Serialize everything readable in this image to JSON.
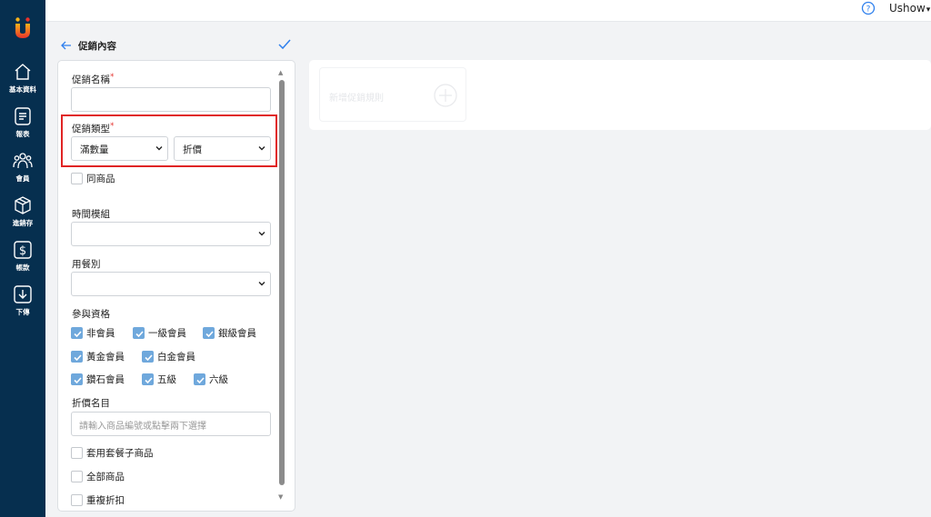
{
  "sidebar": {
    "items": [
      {
        "label": "基本資料",
        "icon": "home-icon"
      },
      {
        "label": "報表",
        "icon": "report-icon"
      },
      {
        "label": "會員",
        "icon": "members-icon"
      },
      {
        "label": "進銷存",
        "icon": "inventory-box-icon"
      },
      {
        "label": "帳款",
        "icon": "dollar-icon"
      },
      {
        "label": "下傳",
        "icon": "download-icon"
      }
    ]
  },
  "topbar": {
    "user": "Ushow",
    "caret": "▾"
  },
  "header": {
    "title": "促銷內容"
  },
  "form": {
    "promo_name": {
      "label": "促銷名稱",
      "required_mark": "*",
      "value": ""
    },
    "promo_type": {
      "label": "促銷類型",
      "required_mark": "*",
      "select1": "滿數量",
      "select2": "折價"
    },
    "same_product": {
      "label": "同商品",
      "checked": false
    },
    "time_template": {
      "label": "時間模組",
      "value": ""
    },
    "dining_type": {
      "label": "用餐別",
      "value": ""
    },
    "eligibility": {
      "label": "參與資格",
      "options": [
        {
          "label": "非會員",
          "checked": true
        },
        {
          "label": "一級會員",
          "checked": true
        },
        {
          "label": "銀級會員",
          "checked": true
        },
        {
          "label": "黃金會員",
          "checked": true
        },
        {
          "label": "白金會員",
          "checked": true
        },
        {
          "label": "鑽石會員",
          "checked": true
        },
        {
          "label": "五級",
          "checked": true
        },
        {
          "label": "六級",
          "checked": true
        }
      ]
    },
    "discount_items": {
      "label": "折價名目",
      "placeholder": "請輸入商品編號或點擊兩下選擇"
    },
    "apply_combo": {
      "label": "套用套餐子商品",
      "checked": false
    },
    "all_products": {
      "label": "全部商品",
      "checked": false
    },
    "repeat_discount": {
      "label": "重複折扣",
      "checked": false
    }
  },
  "right_panel": {
    "tile_label": "新增促銷規則"
  },
  "colors": {
    "sidebar": "#062f4f",
    "accent": "#6fa8dc",
    "highlight": "#e02424"
  }
}
